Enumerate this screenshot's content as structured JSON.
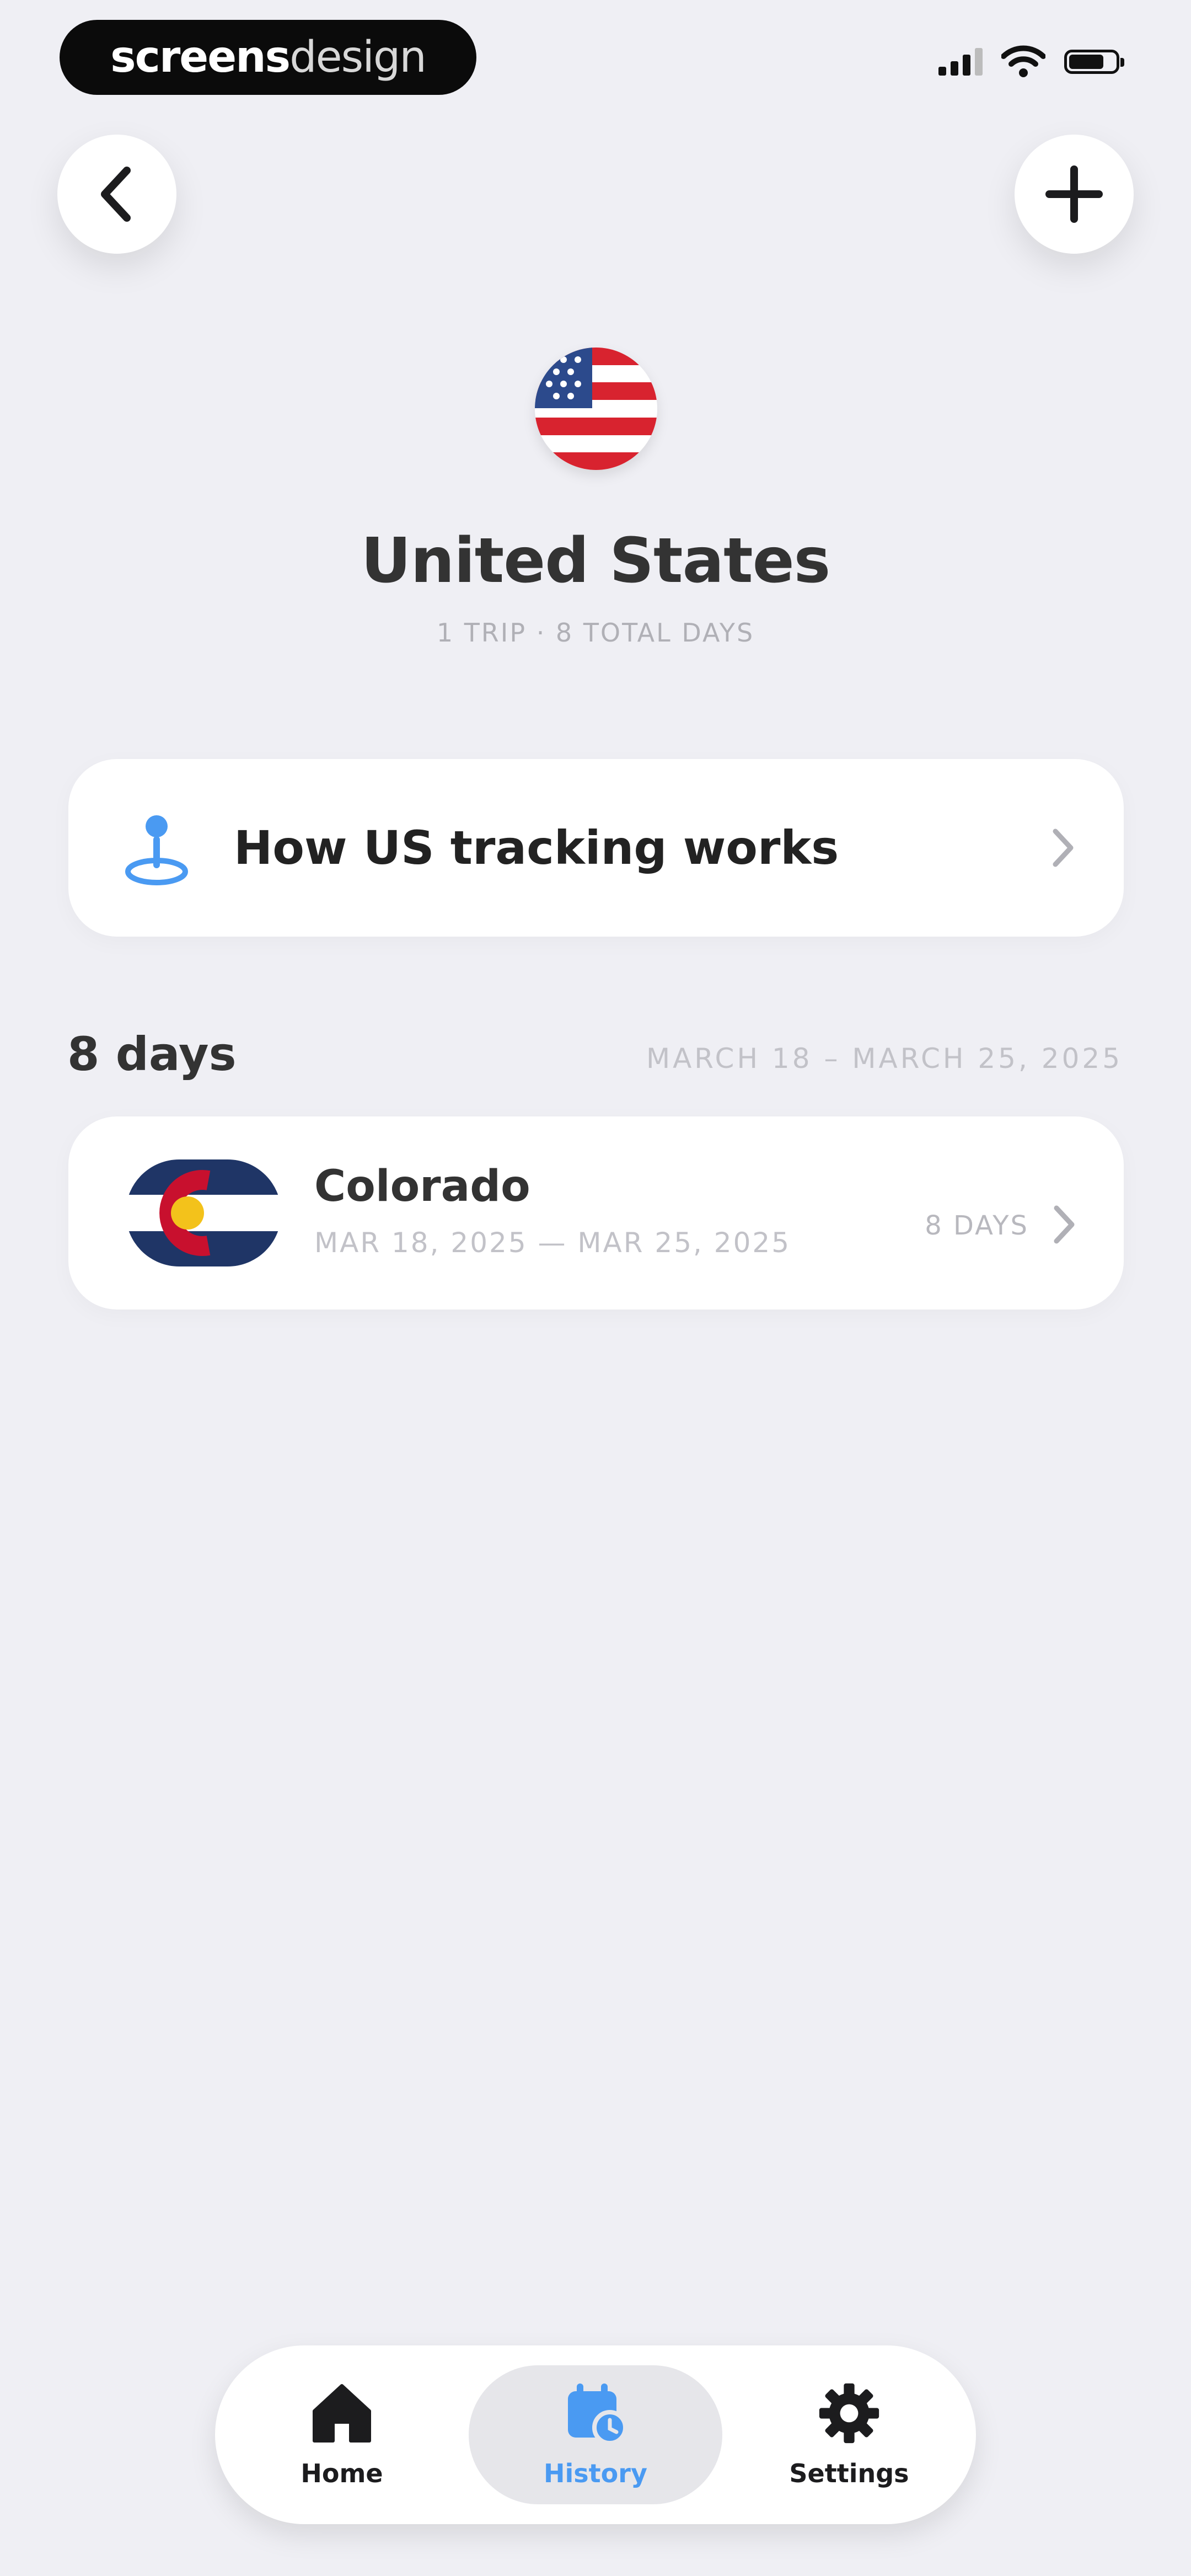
{
  "watermark": {
    "bold": "screens",
    "light": "design"
  },
  "header": {
    "title": "United States",
    "subtitle": "1 TRIP · 8 TOTAL DAYS"
  },
  "info_card": {
    "label": "How US tracking works"
  },
  "section": {
    "days_label": "8 days",
    "range_label": "MARCH 18 – MARCH 25, 2025"
  },
  "trips": [
    {
      "name": "Colorado",
      "dates": "MAR 18, 2025 — MAR 25, 2025",
      "days": "8 DAYS"
    }
  ],
  "tabs": [
    {
      "label": "Home",
      "icon": "home-icon"
    },
    {
      "label": "History",
      "icon": "history-icon",
      "selected": true
    },
    {
      "label": "Settings",
      "icon": "gear-icon"
    }
  ],
  "colors": {
    "background": "#efeff4",
    "accent": "#4a9af2",
    "card": "#ffffff"
  }
}
